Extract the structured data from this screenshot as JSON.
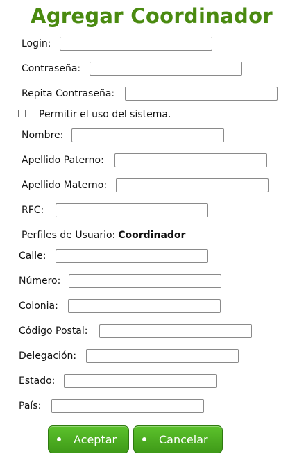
{
  "page": {
    "title": "Agregar Coordinador"
  },
  "form": {
    "login": {
      "label": "Login:",
      "value": ""
    },
    "password": {
      "label": "Contraseña:",
      "value": ""
    },
    "password_repeat": {
      "label": "Repita Contraseña:",
      "value": ""
    },
    "allow_system": {
      "label": "Permitir el uso del sistema.",
      "checked": false
    },
    "name": {
      "label": "Nombre:",
      "value": ""
    },
    "last_name_paternal": {
      "label": "Apellido Paterno:",
      "value": ""
    },
    "last_name_maternal": {
      "label": "Apellido Materno:",
      "value": ""
    },
    "rfc": {
      "label": "RFC:",
      "value": ""
    },
    "profiles": {
      "label": "Perfiles de Usuario:",
      "value": "Coordinador"
    },
    "street": {
      "label": "Calle:",
      "value": ""
    },
    "number": {
      "label": "Número:",
      "value": ""
    },
    "colony": {
      "label": "Colonia:",
      "value": ""
    },
    "postal_code": {
      "label": "Código Postal:",
      "value": ""
    },
    "delegation": {
      "label": "Delegación:",
      "value": ""
    },
    "state": {
      "label": "Estado:",
      "value": ""
    },
    "country": {
      "label": "País:",
      "value": ""
    }
  },
  "buttons": {
    "accept": "Aceptar",
    "cancel": "Cancelar"
  },
  "colors": {
    "title": "#4a8a10",
    "button": "#4caf1f",
    "button_border": "#2f7a10"
  }
}
